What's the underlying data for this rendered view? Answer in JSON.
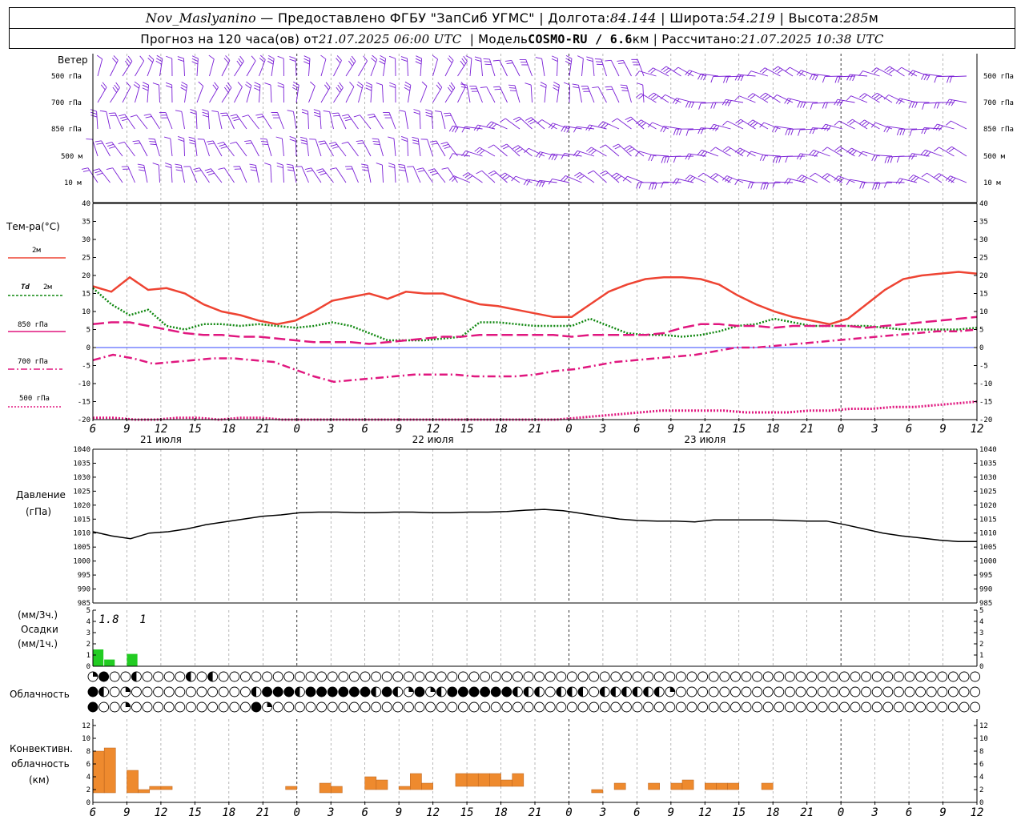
{
  "header": {
    "station": "Nov_Maslyanino",
    "provider": "Предоставлено ФГБУ \"ЗапСиб УГМС\"",
    "lon_label": "Долгота:",
    "lon": "84.144",
    "lat_label": "Широта:",
    "lat": "54.219",
    "alt_label": "Высота:",
    "alt": "285",
    "alt_unit": "м",
    "forecast_label": "Прогноз на 120 часа(ов) от",
    "forecast_start": "21.07.2025 06:00 UTC",
    "model_label": "Модель",
    "model": "COSMO-RU / 6.6",
    "model_unit": "км",
    "calc_label": "Рассчитано:",
    "calc_time": "21.07.2025 10:38 UTC"
  },
  "labels": {
    "wind": "Ветер",
    "wind_levels": [
      "500 гПа",
      "700 гПа",
      "850 гПа",
      "500 м",
      "10  м"
    ],
    "temp_title": "Тем-ра(°C)",
    "t2m": "2м",
    "td": "Td",
    "td2m": "2м",
    "t850": "850 гПа",
    "t700": "700 гПа",
    "t500": "500 гПа",
    "pressure_title": "Давление",
    "pressure_unit": "(гПа)",
    "precip_unit1": "(мм/3ч.)",
    "precip_title": "Осадки",
    "precip_unit2": "(мм/1ч.)",
    "cloud_title": "Облачность",
    "conv_title1": "Конвективн.",
    "conv_title2": "облачность",
    "conv_unit": "(км)"
  },
  "colors": {
    "t2m": "#ee4433",
    "td": "#118811",
    "t850": "#e0177f",
    "t700": "#e0177f",
    "t500": "#e0177f",
    "wind": "#7a1fd6",
    "precip": "#22cc22",
    "conv": "#ee8a2e",
    "grid": "#777777"
  },
  "chart_data": {
    "type": "line",
    "x_ticks": [
      "6",
      "9",
      "12",
      "15",
      "18",
      "21",
      "0",
      "3",
      "6",
      "9",
      "12",
      "15",
      "18",
      "21",
      "0",
      "3",
      "6",
      "9",
      "12",
      "15",
      "18",
      "21",
      "0",
      "3",
      "6",
      "9",
      "12"
    ],
    "days": [
      "21 июля",
      "22 июля",
      "23 июля"
    ],
    "temperature": {
      "ylim": [
        -20,
        40
      ],
      "ticks": [
        "40",
        "35",
        "30",
        "25",
        "20",
        "15",
        "10",
        "5",
        "0",
        "-5",
        "-10",
        "-15",
        "-20"
      ],
      "series": [
        {
          "name": "2м",
          "style": "solid",
          "values": [
            17,
            15.5,
            19.5,
            16,
            16.5,
            15,
            12,
            10,
            9,
            7.5,
            6.5,
            7.5,
            10,
            13,
            14,
            15,
            13.5,
            15.5,
            15,
            15,
            13.5,
            12,
            11.5,
            10.5,
            9.5,
            8.5,
            8.5,
            12,
            15.5,
            17.5,
            19,
            19.5,
            19.5,
            19,
            17.5,
            14.5,
            12,
            10,
            8.5,
            7.5,
            6.5,
            8,
            12,
            16,
            19,
            20,
            20.5,
            21,
            20.5
          ]
        },
        {
          "name": "Td 2м",
          "style": "dotted",
          "values": [
            16.5,
            12,
            9,
            10.5,
            6,
            5,
            6.5,
            6.5,
            6,
            6.5,
            6,
            5.5,
            6,
            7,
            6,
            4,
            2,
            2,
            2,
            2.5,
            3,
            7,
            7,
            6.5,
            6,
            6,
            6,
            8,
            6,
            4,
            3.5,
            3.5,
            3,
            3.5,
            4.5,
            6,
            6.5,
            8,
            7,
            6,
            6,
            6,
            6,
            5.5,
            5,
            5,
            5,
            5,
            5.5
          ]
        },
        {
          "name": "850 гПа",
          "style": "dashed",
          "values": [
            6.5,
            7,
            7,
            6,
            5,
            4,
            3.5,
            3.5,
            3,
            3,
            2.5,
            2,
            1.5,
            1.5,
            1.5,
            1,
            1.5,
            2,
            2.5,
            3,
            3,
            3.5,
            3.5,
            3.5,
            3.5,
            3.5,
            3,
            3.5,
            3.5,
            3.5,
            3.5,
            4,
            5.5,
            6.5,
            6.5,
            6,
            6,
            5.5,
            6,
            6,
            6,
            6,
            5.5,
            6,
            6.5,
            7,
            7.5,
            8,
            8.5
          ]
        },
        {
          "name": "700 гПа",
          "style": "dashdot",
          "values": [
            -3.5,
            -2,
            -3,
            -4.5,
            -4,
            -3.5,
            -3,
            -3,
            -3.5,
            -4,
            -6,
            -8,
            -9.5,
            -9,
            -8.5,
            -8,
            -7.5,
            -7.5,
            -7.5,
            -8,
            -8,
            -8,
            -7.5,
            -6.5,
            -6,
            -5,
            -4,
            -3.5,
            -3,
            -2.5,
            -2,
            -1,
            0,
            0,
            0.5,
            1,
            1.5,
            2,
            2.5,
            3,
            3.5,
            4,
            4.5,
            4.5,
            5
          ]
        },
        {
          "name": "500 гПа",
          "style": "dotted",
          "values": [
            -19.5,
            -19.5,
            -20,
            -20,
            -19.5,
            -19.5,
            -20,
            -19.5,
            -19.5,
            -20,
            -20,
            -20,
            -20,
            -20,
            -20,
            -20,
            -20,
            -20,
            -20,
            -20,
            -20,
            -20,
            -20,
            -19.5,
            -19,
            -18.5,
            -18,
            -17.5,
            -17.5,
            -17.5,
            -17.5,
            -18,
            -18,
            -18,
            -17.5,
            -17.5,
            -17,
            -17,
            -16.5,
            -16.5,
            -16,
            -15.5,
            -15
          ]
        }
      ]
    },
    "pressure": {
      "ylim": [
        985,
        1040
      ],
      "ticks": [
        "1040",
        "1035",
        "1030",
        "1025",
        "1020",
        "1015",
        "1010",
        "1005",
        "1000",
        "995",
        "990",
        "985"
      ],
      "values": [
        1010.5,
        1009,
        1008,
        1010,
        1010.5,
        1011.5,
        1013,
        1014,
        1015,
        1016,
        1016.5,
        1017.3,
        1017.5,
        1017.5,
        1017.3,
        1017.3,
        1017.5,
        1017.5,
        1017.3,
        1017.3,
        1017.5,
        1017.5,
        1017.7,
        1018.2,
        1018.5,
        1018,
        1017,
        1016,
        1015,
        1014.5,
        1014.3,
        1014.3,
        1014,
        1014.7,
        1014.7,
        1014.7,
        1014.7,
        1014.5,
        1014.3,
        1014.3,
        1013,
        1011.5,
        1010,
        1009,
        1008.3,
        1007.5,
        1007,
        1007
      ]
    },
    "precip": {
      "ylim": [
        0,
        5
      ],
      "ticks": [
        "5",
        "4",
        "3",
        "2",
        "1",
        "0"
      ],
      "bars_mm1h": [
        1.5,
        0.6,
        0,
        1.1
      ],
      "labels_3h": [
        "1.8",
        "1"
      ]
    },
    "convective": {
      "ylim": [
        0,
        13
      ],
      "ticks": [
        "12",
        "10",
        "8",
        "6",
        "4",
        "2",
        "0"
      ],
      "bars": [
        [
          0,
          1.5,
          8
        ],
        [
          1,
          1.5,
          8.5
        ],
        [
          3,
          1.5,
          5
        ],
        [
          4,
          1.5,
          2
        ],
        [
          5,
          2,
          2.5
        ],
        [
          6,
          2,
          2.5
        ],
        [
          17,
          2,
          2.5
        ],
        [
          20,
          1.5,
          3
        ],
        [
          21,
          1.5,
          2.5
        ],
        [
          24,
          2,
          4
        ],
        [
          25,
          2,
          3.5
        ],
        [
          27,
          2,
          2.5
        ],
        [
          28,
          2,
          4.5
        ],
        [
          29,
          2,
          3
        ],
        [
          32,
          2.5,
          4.5
        ],
        [
          33,
          2.5,
          4.5
        ],
        [
          34,
          2.5,
          4.5
        ],
        [
          35,
          2.5,
          4.5
        ],
        [
          36,
          2.5,
          3.5
        ],
        [
          37,
          2.5,
          4.5
        ],
        [
          44,
          1.5,
          2
        ],
        [
          46,
          2,
          3
        ],
        [
          49,
          2,
          3
        ],
        [
          51,
          2,
          3
        ],
        [
          52,
          2,
          3.5
        ],
        [
          54,
          2,
          3
        ],
        [
          55,
          2,
          3
        ],
        [
          56,
          2,
          3
        ],
        [
          59,
          2,
          3
        ]
      ]
    },
    "wind_rows": 5
  }
}
